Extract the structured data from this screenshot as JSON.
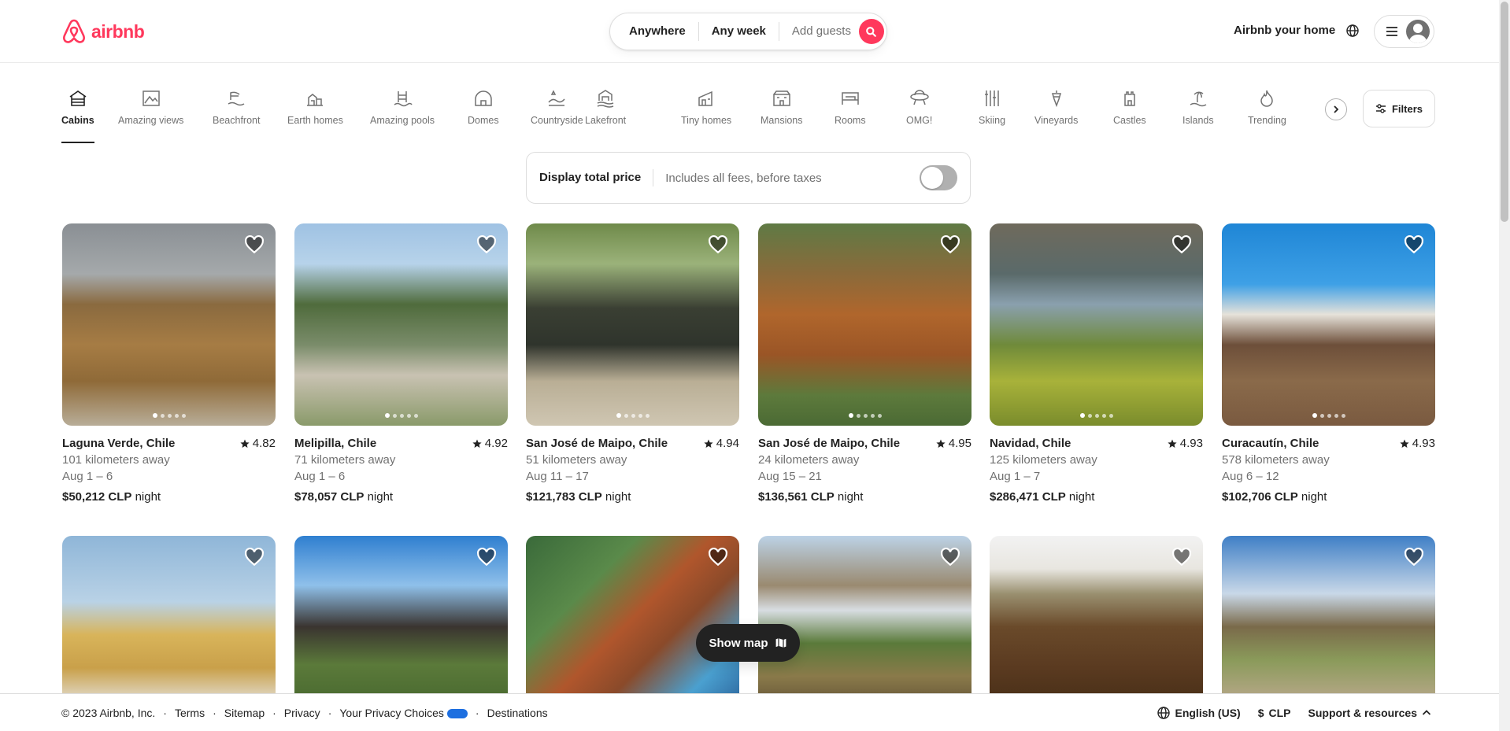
{
  "brand": {
    "name": "airbnb",
    "color": "#ff385c"
  },
  "search": {
    "anywhere": "Anywhere",
    "any_week": "Any week",
    "guests": "Add guests"
  },
  "header": {
    "host_link": "Airbnb your home"
  },
  "categories": [
    {
      "label": "Cabins",
      "icon": "cabin-icon",
      "active": true
    },
    {
      "label": "Amazing views",
      "icon": "view-icon"
    },
    {
      "label": "Beachfront",
      "icon": "beach-icon"
    },
    {
      "label": "Earth homes",
      "icon": "earth-home-icon"
    },
    {
      "label": "Amazing pools",
      "icon": "pool-icon"
    },
    {
      "label": "Domes",
      "icon": "dome-icon"
    },
    {
      "label": "Countryside",
      "icon": "countryside-icon"
    },
    {
      "label": "Lakefront",
      "icon": "lake-icon"
    },
    {
      "label": "Tiny homes",
      "icon": "tiny-home-icon"
    },
    {
      "label": "Mansions",
      "icon": "mansion-icon"
    },
    {
      "label": "Rooms",
      "icon": "room-icon"
    },
    {
      "label": "OMG!",
      "icon": "omg-icon"
    },
    {
      "label": "Skiing",
      "icon": "ski-icon"
    },
    {
      "label": "Vineyards",
      "icon": "vineyard-icon"
    },
    {
      "label": "Castles",
      "icon": "castle-icon"
    },
    {
      "label": "Islands",
      "icon": "island-icon"
    },
    {
      "label": "Trending",
      "icon": "trending-icon"
    }
  ],
  "filters": {
    "label": "Filters"
  },
  "total_price": {
    "title": "Display total price",
    "subtitle": "Includes all fees, before taxes",
    "enabled": false
  },
  "listings": [
    {
      "location": "Laguna Verde, Chile",
      "rating": "4.82",
      "distance": "101 kilometers away",
      "dates": "Aug 1 – 6",
      "price": "$50,212 CLP",
      "unit": "night"
    },
    {
      "location": "Melipilla, Chile",
      "rating": "4.92",
      "distance": "71 kilometers away",
      "dates": "Aug 1 – 6",
      "price": "$78,057 CLP",
      "unit": "night"
    },
    {
      "location": "San José de Maipo, Chile",
      "rating": "4.94",
      "distance": "51 kilometers away",
      "dates": "Aug 11 – 17",
      "price": "$121,783 CLP",
      "unit": "night"
    },
    {
      "location": "San José de Maipo, Chile",
      "rating": "4.95",
      "distance": "24 kilometers away",
      "dates": "Aug 15 – 21",
      "price": "$136,561 CLP",
      "unit": "night"
    },
    {
      "location": "Navidad, Chile",
      "rating": "4.93",
      "distance": "125 kilometers away",
      "dates": "Aug 1 – 7",
      "price": "$286,471 CLP",
      "unit": "night"
    },
    {
      "location": "Curacautín, Chile",
      "rating": "4.93",
      "distance": "578 kilometers away",
      "dates": "Aug 6 – 12",
      "price": "$102,706 CLP",
      "unit": "night"
    }
  ],
  "show_map": {
    "label": "Show map"
  },
  "footer": {
    "copyright": "© 2023 Airbnb, Inc.",
    "links": [
      "Terms",
      "Sitemap",
      "Privacy",
      "Your Privacy Choices",
      "Destinations"
    ],
    "language": "English (US)",
    "currency_symbol": "$",
    "currency": "CLP",
    "support": "Support & resources"
  }
}
